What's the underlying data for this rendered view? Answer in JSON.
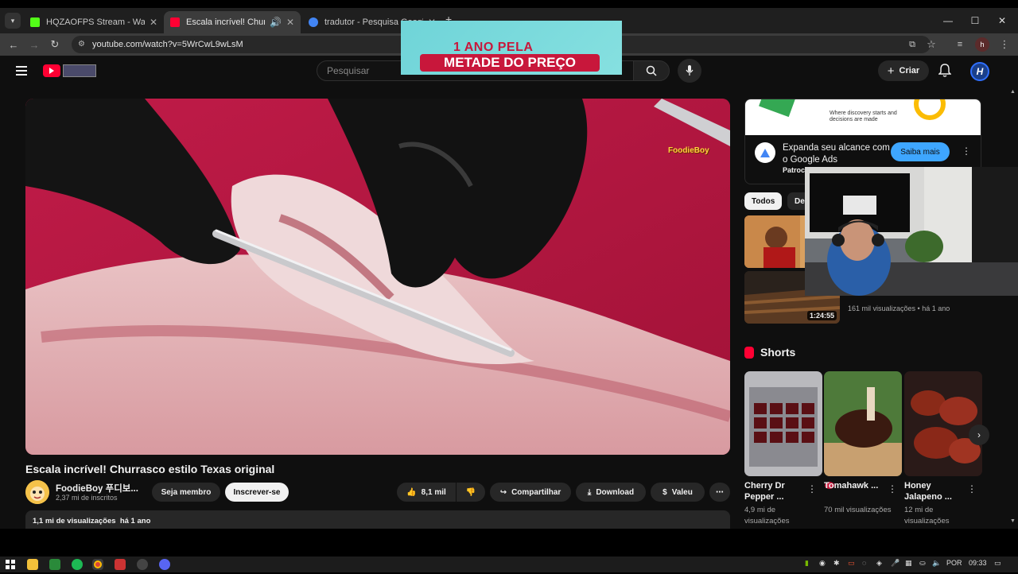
{
  "browser": {
    "tabs": [
      {
        "title": "HQZAOFPS Stream - Watch Live",
        "color": "#53fc18"
      },
      {
        "title": "Escala incrível! Churrasco estilo",
        "color": "#ff0033"
      },
      {
        "title": "tradutor - Pesquisa Google",
        "color": "#4285f4"
      }
    ],
    "url": "youtube.com/watch?v=5WrCwL9wLsM",
    "profile_initial": "h"
  },
  "youtube": {
    "search_placeholder": "Pesquisar",
    "create_label": "Criar",
    "avatar_letter": "H"
  },
  "video": {
    "title": "Escala incrível! Churrasco estilo Texas original",
    "channel_name": "FoodieBoy 푸디보...",
    "channel_subs": "2,37 mi de inscritos",
    "member_label": "Seja membro",
    "subscribe_label": "Inscrever-se",
    "likes": "8,1 mil",
    "share_label": "Compartilhar",
    "download_label": "Download",
    "thanks_label": "Valeu",
    "views_date": "1,1 mi de visualizações  há 1 ano",
    "watermark": "FoodieBoy"
  },
  "ad": {
    "banner_text": "Where discovery starts and decisions are made",
    "headline": "Expanda seu alcance com o Google Ads",
    "sponsor": "Patroc",
    "cta": "Saiba mais"
  },
  "chips": [
    "Todos",
    "De"
  ],
  "recommended": {
    "duration": "1:24:55",
    "meta": "161 mil visualizações • há 1 ano"
  },
  "shorts": {
    "heading": "Shorts",
    "items": [
      {
        "title": "Cherry Dr Pepper ...",
        "views": "4,9 mi de visualizações"
      },
      {
        "title": "Tomahawk ...",
        "views": "70 mil visualizações"
      },
      {
        "title": "Honey Jalapeno ...",
        "views": "12 mi de visualizações"
      }
    ]
  },
  "promo": {
    "line1": "1 ANO PELA",
    "line2": "METADE DO PREÇO"
  },
  "taskbar": {
    "language": "POR",
    "time": "09:33"
  }
}
